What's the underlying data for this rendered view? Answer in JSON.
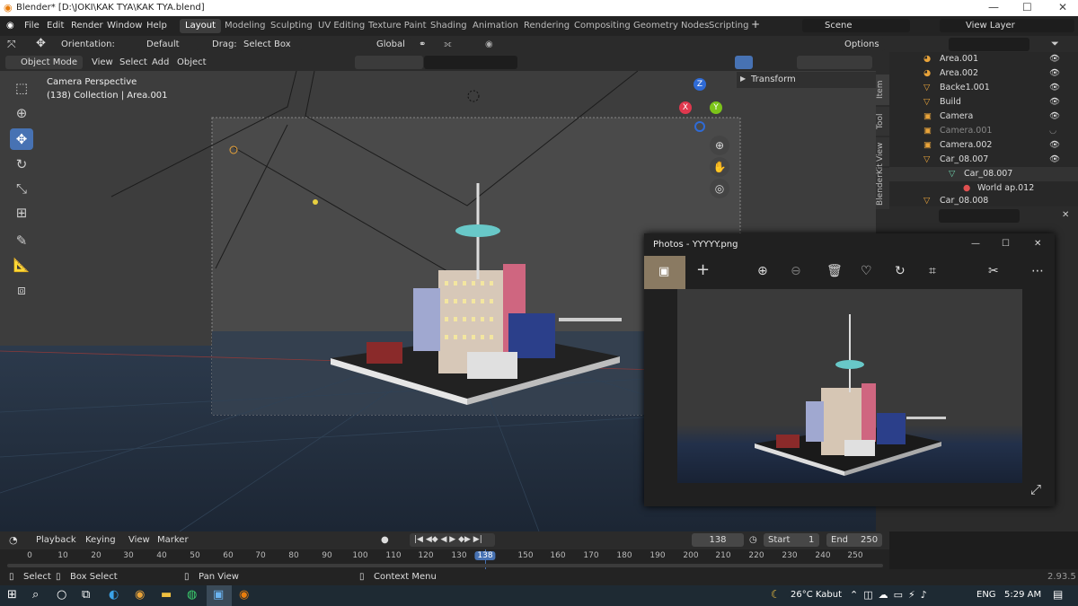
{
  "window": {
    "title": "Blender* [D:\\JOKI\\KAK TYA\\KAK TYA.blend]",
    "min": "—",
    "max": "☐",
    "close": "✕"
  },
  "menu": [
    "File",
    "Edit",
    "Render",
    "Window",
    "Help"
  ],
  "workspaces": [
    "Layout",
    "Modeling",
    "Sculpting",
    "UV Editing",
    "Texture Paint",
    "Shading",
    "Animation",
    "Rendering",
    "Compositing",
    "Geometry Nodes",
    "Scripting"
  ],
  "scene": {
    "label": "Scene",
    "view_layer": "View Layer"
  },
  "tool_header": {
    "orientation_label": "Orientation:",
    "orientation_value": "Default",
    "drag_label": "Drag:",
    "drag_value": "Select Box",
    "transform_value": "Global",
    "options": "Options"
  },
  "viewport_header": {
    "mode": "Object Mode",
    "view": "View",
    "select": "Select",
    "add": "Add",
    "object": "Object"
  },
  "viewport": {
    "camera_line1": "Camera Perspective",
    "camera_line2": "(138) Collection | Area.001",
    "gizmo_z": "Z",
    "gizmo_x": "X",
    "gizmo_y": "Y"
  },
  "n_panel": {
    "transform": "Transform",
    "tabs": [
      "Item",
      "Tool",
      "View",
      "BlenderKit"
    ]
  },
  "outliner": [
    {
      "name": "Area.001",
      "type": "light"
    },
    {
      "name": "Area.002",
      "type": "light"
    },
    {
      "name": "Backe1.001",
      "type": "mesh"
    },
    {
      "name": "Build",
      "type": "mesh"
    },
    {
      "name": "Camera",
      "type": "camera"
    },
    {
      "name": "Camera.001",
      "type": "camera"
    },
    {
      "name": "Camera.002",
      "type": "camera"
    },
    {
      "name": "Car_08.007",
      "type": "mesh"
    },
    {
      "name": "Car_08.007",
      "type": "mesh-data"
    },
    {
      "name": "World ap.012",
      "type": "material"
    },
    {
      "name": "Car_08.008",
      "type": "mesh"
    }
  ],
  "timeline_header": {
    "playback": "Playback",
    "keying": "Keying",
    "view": "View",
    "marker": "Marker",
    "current_frame": "138",
    "start_label": "Start",
    "start_value": "1",
    "end_label": "End",
    "end_value": "250"
  },
  "timeline_ticks": [
    "0",
    "10",
    "20",
    "30",
    "40",
    "50",
    "60",
    "70",
    "80",
    "90",
    "100",
    "110",
    "120",
    "130",
    "138",
    "150",
    "160",
    "170",
    "180",
    "190",
    "200",
    "210",
    "220",
    "230",
    "240",
    "250"
  ],
  "statusbar": {
    "select": "Select",
    "box_select": "Box Select",
    "pan_view": "Pan View",
    "context_menu": "Context Menu",
    "version": "2.93.5"
  },
  "photos": {
    "title": "Photos - YYYYY.png",
    "min": "—",
    "max": "☐",
    "close": "✕"
  },
  "taskbar": {
    "weather": "26°C Kabut",
    "lang": "ENG",
    "time": "5:29 AM"
  },
  "colors": {
    "accent": "#4772b3",
    "orange": "#e8a33a",
    "green": "#6bc9a5",
    "photos_bg": "#202020"
  }
}
